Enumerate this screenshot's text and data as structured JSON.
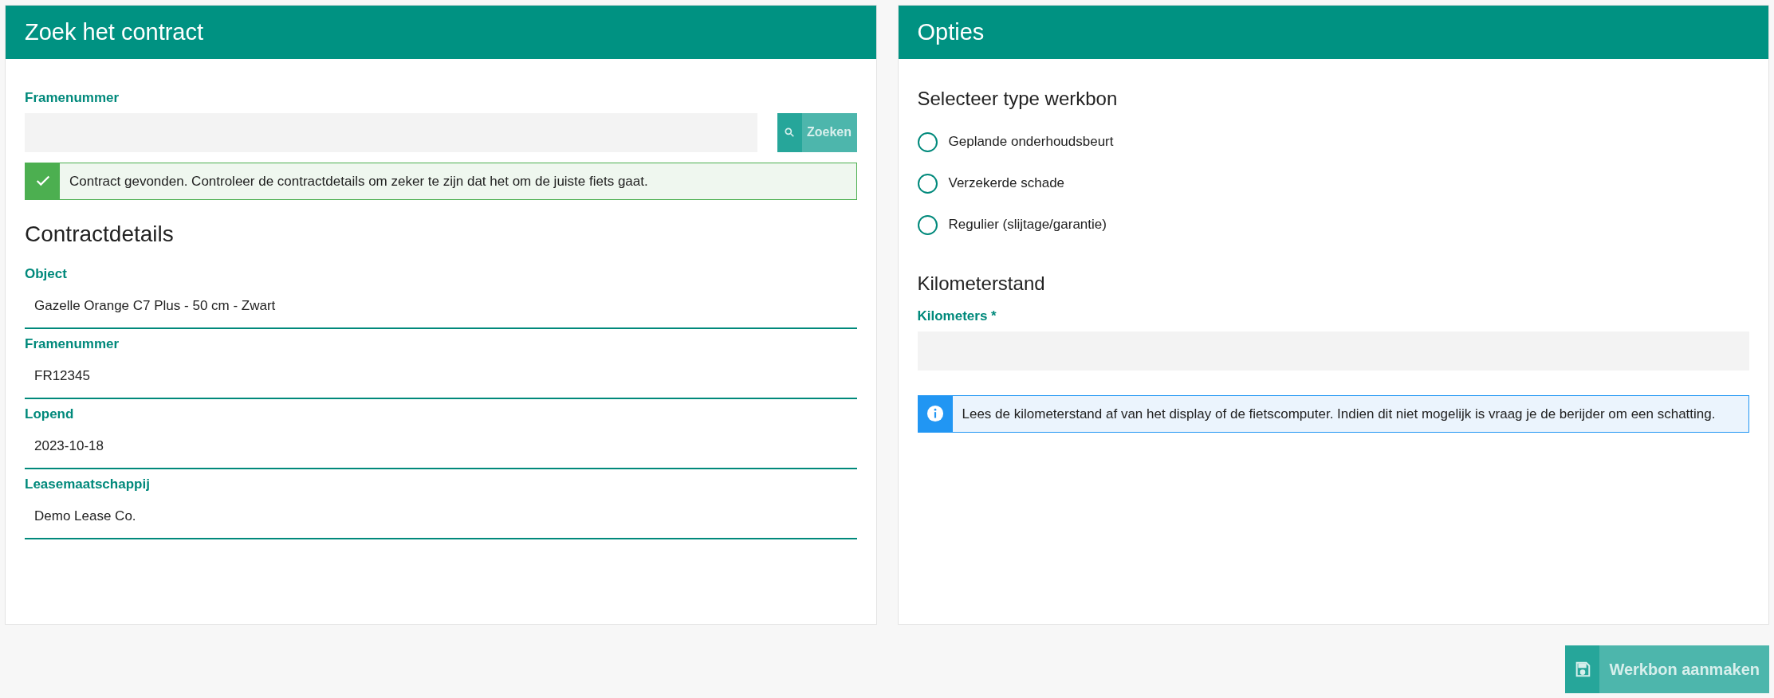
{
  "search_panel": {
    "title": "Zoek het contract",
    "frame_field": {
      "label": "Framenummer"
    },
    "search_button": {
      "label": "Zoeken",
      "disabled": true
    },
    "alert": {
      "kind": "success",
      "text": "Contract gevonden. Controleer de contractdetails om zeker te zijn dat het om de juiste fiets gaat."
    },
    "details_heading": "Contractdetails",
    "details": [
      {
        "label": "Object",
        "value": "Gazelle Orange C7 Plus - 50 cm - Zwart"
      },
      {
        "label": "Framenummer",
        "value": "FR12345"
      },
      {
        "label": "Lopend",
        "value": "2023-10-18"
      },
      {
        "label": "Leasemaatschappij",
        "value": "Demo Lease Co."
      }
    ]
  },
  "options_panel": {
    "title": "Opties",
    "type_heading": "Selecteer type werkbon",
    "types": [
      {
        "label": "Geplande onderhoudsbeurt",
        "selected": false
      },
      {
        "label": "Verzekerde schade",
        "selected": false
      },
      {
        "label": "Regulier (slijtage/garantie)",
        "selected": false
      }
    ],
    "km_heading": "Kilometerstand",
    "km_field": {
      "label": "Kilometers",
      "required_mark": "*"
    },
    "info": {
      "kind": "info",
      "text": "Lees de kilometerstand af van het display of de fietscomputer. Indien dit niet mogelijk is vraag je de berijder om een schatting."
    }
  },
  "submit_button": {
    "label": "Werkbon aanmaken",
    "disabled": true
  }
}
